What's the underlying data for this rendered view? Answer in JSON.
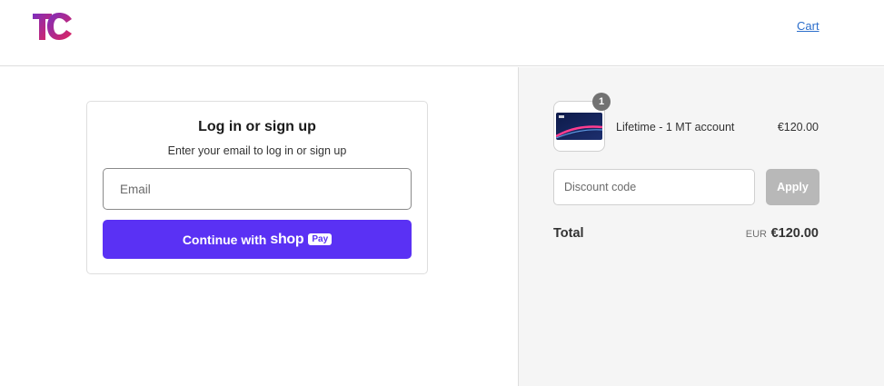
{
  "header": {
    "logo_icon": "tc-logo-icon",
    "cart_label": "Cart"
  },
  "login": {
    "title": "Log in or sign up",
    "subtitle": "Enter your email to log in or sign up",
    "email_placeholder": "Email",
    "email_value": "",
    "continue_label": "Continue with",
    "shop_word": "shop",
    "pay_word": "Pay"
  },
  "order": {
    "item_quantity": "1",
    "item_name": "Lifetime - 1 MT account",
    "item_price": "€120.00",
    "discount_placeholder": "Discount code",
    "apply_label": "Apply",
    "total_label": "Total",
    "total_currency": "EUR",
    "total_amount": "€120.00"
  },
  "colors": {
    "shop_pay_purple": "#5a31f4",
    "link_blue": "#2c6ecb",
    "apply_disabled": "#b8b8b8",
    "sidebar_bg": "#f5f5f5"
  }
}
